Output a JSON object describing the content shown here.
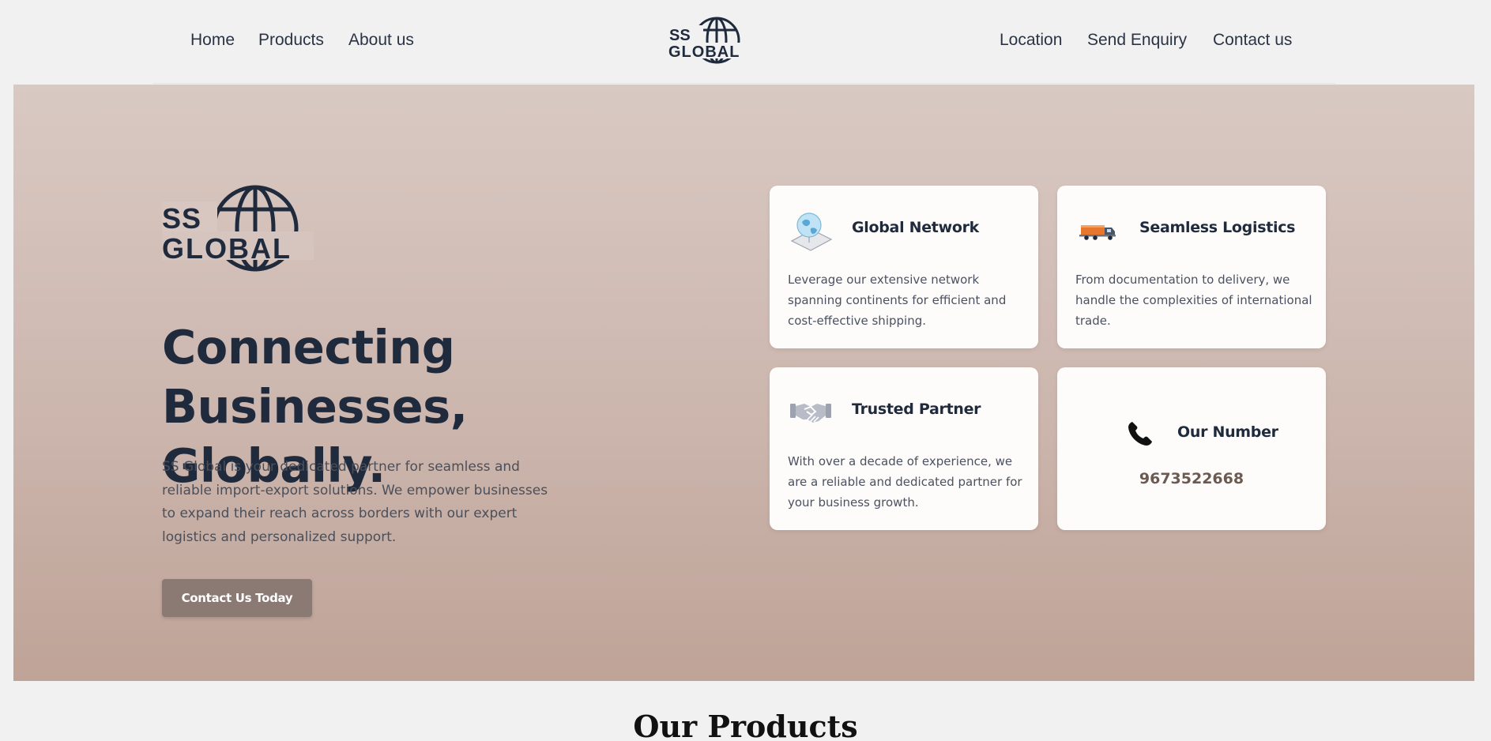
{
  "nav": {
    "left_links": [
      "Home",
      "Products",
      "About us"
    ],
    "right_links": [
      "Location",
      "Send Enquiry",
      "Contact us"
    ],
    "logo": {
      "line1": "SS",
      "line2": "GLOBAL"
    }
  },
  "hero": {
    "logo": {
      "line1": "SS",
      "line2": "GLOBAL"
    },
    "title_line1": "Connecting Businesses,",
    "title_line2": "Globally.",
    "description": "SS Global is your dedicated partner for seamless and reliable import-export solutions. We empower businesses to expand their reach across borders with our expert logistics and personalized support.",
    "cta_label": "Contact Us Today"
  },
  "cards": [
    {
      "icon": "globe-network-icon",
      "title": "Global Network",
      "text": "Leverage our extensive network spanning continents for efficient and cost-effective shipping."
    },
    {
      "icon": "truck-icon",
      "title": "Seamless Logistics",
      "text": "From documentation to delivery, we handle the complexities of international trade."
    },
    {
      "icon": "handshake-icon",
      "title": "Trusted Partner",
      "text": "With over a decade of experience, we are a reliable and dedicated partner for your business growth."
    }
  ],
  "contact_card": {
    "icon": "phone-icon",
    "title": "Our Number",
    "number": "9673522668"
  },
  "products": {
    "heading": "Our Products"
  },
  "colors": {
    "hero_top": "#d9c9c3",
    "hero_bottom": "#bfa397",
    "brand_navy": "#1f2a3d",
    "button": "#8b7a73"
  }
}
